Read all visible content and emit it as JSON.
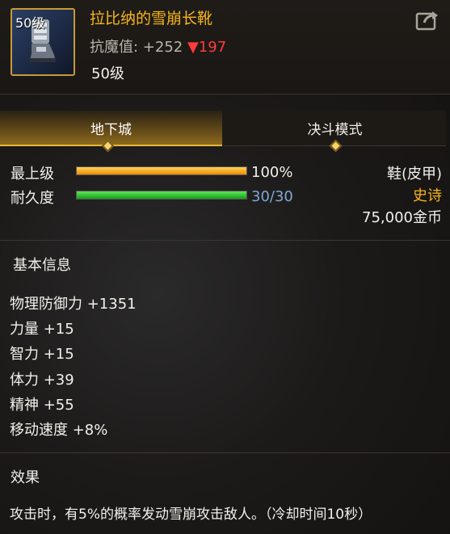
{
  "item": {
    "icon_level": "50级",
    "name": "拉比纳的雪崩长靴",
    "stat_label": "抗魔值:",
    "stat_value": " +252 ",
    "stat_delta": "▼197",
    "level": "50级"
  },
  "tabs": [
    {
      "label": "地下城",
      "active": true
    },
    {
      "label": "决斗模式",
      "active": false
    }
  ],
  "bars": [
    {
      "label": "最上级",
      "value_text": "100%",
      "fraction": 1.0,
      "color": "orange"
    },
    {
      "label": "耐久度",
      "value_text": "30/30",
      "fraction": 1.0,
      "color": "green"
    }
  ],
  "info": {
    "type": "鞋(皮甲)",
    "rarity": "史诗",
    "price": "75,000金币"
  },
  "basic": {
    "title": "基本信息",
    "attributes": [
      "物理防御力 +1351",
      "力量 +15",
      "智力 +15",
      "体力 +39",
      "精神 +55",
      "移动速度 +8%"
    ]
  },
  "effect": {
    "title": "效果",
    "text": "攻击时，有5%的概率发动雪崩攻击敌人。（冷却时间10秒）"
  },
  "colors": {
    "name": "#f7b51b",
    "rarity": "#f7b51b",
    "durability_value": "#7fa7d8",
    "delta": "#ff3b3b"
  }
}
